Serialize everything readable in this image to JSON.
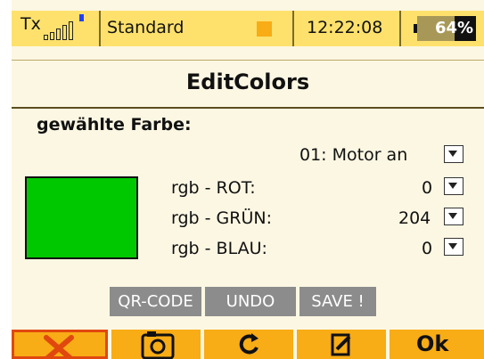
{
  "status": {
    "tx_label": "Tx",
    "model": "Standard",
    "time": "12:22:08",
    "battery": "64%",
    "battery_level": 0.64
  },
  "screen_title": "EditColors",
  "selected_color_label": "gewählte Farbe:",
  "selected_item": "01: Motor an",
  "preview_color": "#00c800",
  "channels": [
    {
      "label": "rgb - ROT:",
      "value": "0"
    },
    {
      "label": "rgb - GRÜN:",
      "value": "204"
    },
    {
      "label": "rgb - BLAU:",
      "value": "0"
    }
  ],
  "buttons": {
    "qr": "QR-CODE",
    "undo": "UNDO",
    "save": "SAVE !"
  },
  "nav": {
    "ok": "Ok"
  },
  "colors": {
    "accent": "#f8ac15",
    "status_bg": "#fde16c",
    "screen_bg": "#fcf7e3",
    "button_gray": "#8c8c8c"
  },
  "icons": [
    "tools-icon",
    "camera-icon",
    "refresh-icon",
    "edit-icon"
  ]
}
